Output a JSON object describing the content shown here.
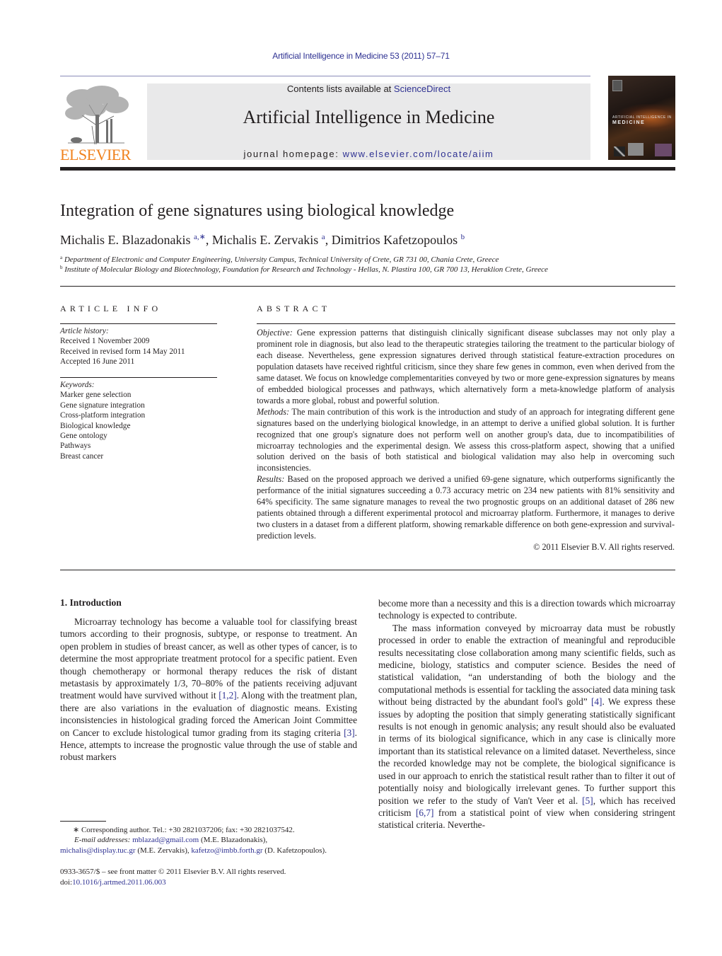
{
  "running_head": "Artificial Intelligence in Medicine 53 (2011) 57–71",
  "masthead": {
    "publisher_logo": "ELSEVIER",
    "contents_prefix": "Contents lists available at ",
    "contents_link": "ScienceDirect",
    "journal_title": "Artificial Intelligence in Medicine",
    "homepage_prefix": "journal homepage: ",
    "homepage_link": "www.elsevier.com/locate/aiim",
    "cover": {
      "line1": "ARTIFICIAL INTELLIGENCE IN",
      "line2": "MEDICINE"
    }
  },
  "article": {
    "title": "Integration of gene signatures using biological knowledge",
    "authors": [
      {
        "name": "Michalis E. Blazadonakis",
        "sup": "a,∗",
        "sep": ", "
      },
      {
        "name": "Michalis E. Zervakis",
        "sup": "a",
        "sep": ", "
      },
      {
        "name": "Dimitrios Kafetzopoulos",
        "sup": "b",
        "sep": ""
      }
    ],
    "affiliations": [
      {
        "key": "a",
        "text": "Department of Electronic and Computer Engineering, University Campus, Technical University of Crete, GR 731 00, Chania Crete, Greece"
      },
      {
        "key": "b",
        "text": "Institute of Molecular Biology and Biotechnology, Foundation for Research and Technology - Hellas, N. Plastira 100, GR 700 13, Heraklion Crete, Greece"
      }
    ]
  },
  "article_info": {
    "heading": "ARTICLE INFO",
    "history_label": "Article history:",
    "history": [
      "Received 1 November 2009",
      "Received in revised form 14 May 2011",
      "Accepted 16 June 2011"
    ],
    "keywords_label": "Keywords:",
    "keywords": [
      "Marker gene selection",
      "Gene signature integration",
      "Cross-platform integration",
      "Biological knowledge",
      "Gene ontology",
      "Pathways",
      "Breast cancer"
    ]
  },
  "abstract": {
    "heading": "ABSTRACT",
    "objective_label": "Objective:",
    "objective": " Gene expression patterns that distinguish clinically significant disease subclasses may not only play a prominent role in diagnosis, but also lead to the therapeutic strategies tailoring the treatment to the particular biology of each disease. Nevertheless, gene expression signatures derived through statistical feature-extraction procedures on population datasets have received rightful criticism, since they share few genes in common, even when derived from the same dataset. We focus on knowledge complementarities conveyed by two or more gene-expression signatures by means of embedded biological processes and pathways, which alternatively form a meta-knowledge platform of analysis towards a more global, robust and powerful solution.",
    "methods_label": "Methods:",
    "methods": " The main contribution of this work is the introduction and study of an approach for integrating different gene signatures based on the underlying biological knowledge, in an attempt to derive a unified global solution. It is further recognized that one group's signature does not perform well on another group's data, due to incompatibilities of microarray technologies and the experimental design. We assess this cross-platform aspect, showing that a unified solution derived on the basis of both statistical and biological validation may also help in overcoming such inconsistencies.",
    "results_label": "Results:",
    "results": " Based on the proposed approach we derived a unified 69-gene signature, which outperforms significantly the performance of the initial signatures succeeding a 0.73 accuracy metric on 234 new patients with 81% sensitivity and 64% specificity. The same signature manages to reveal the two prognostic groups on an additional dataset of 286 new patients obtained through a different experimental protocol and microarray platform. Furthermore, it manages to derive two clusters in a dataset from a different platform, showing remarkable difference on both gene-expression and survival-prediction levels.",
    "copyright": "© 2011 Elsevier B.V. All rights reserved."
  },
  "body": {
    "section_heading": "1.  Introduction",
    "left_p1_a": "Microarray technology has become a valuable tool for classifying breast tumors according to their prognosis, subtype, or response to treatment. An open problem in studies of breast cancer, as well as other types of cancer, is to determine the most appropriate treatment protocol for a specific patient. Even though chemotherapy or hormonal therapy reduces the risk of distant metastasis by approximately 1/3, 70–80% of the patients receiving adjuvant treatment would have survived without it ",
    "cite_1_2": "[1,2]",
    "left_p1_b": ". Along with the treatment plan, there are also variations in the evaluation of diagnostic means. Existing inconsistencies in histological grading forced the American Joint Committee on Cancer to exclude histological tumor grading from its staging criteria ",
    "cite_3": "[3]",
    "left_p1_c": ". Hence, attempts to increase the prognostic value through the use of stable and robust markers",
    "right_p1": "become more than a necessity and this is a direction towards which microarray technology is expected to contribute.",
    "right_p2_a": "The mass information conveyed by microarray data must be robustly processed in order to enable the extraction of meaningful and reproducible results necessitating close collaboration among many scientific fields, such as medicine, biology, statistics and computer science. Besides the need of statistical validation, “an understanding of both the biology and the computational methods is essential for tackling the associated data mining task without being distracted by the abundant fool's gold” ",
    "cite_4": "[4]",
    "right_p2_b": ". We express these issues by adopting the position that simply generating statistically significant results is not enough in genomic analysis; any result should also be evaluated in terms of its biological significance, which in any case is clinically more important than its statistical relevance on a limited dataset. Nevertheless, since the recorded knowledge may not be complete, the biological significance is used in our approach to enrich the statistical result rather than to filter it out of potentially noisy and biologically irrelevant genes. To further support this position we refer to the study of Van't Veer et al. ",
    "cite_5": "[5]",
    "right_p2_c": ", which has received criticism ",
    "cite_6_7": "[6,7]",
    "right_p2_d": " from a statistical point of view when considering stringent statistical criteria. Neverthe-"
  },
  "footnotes": {
    "corresponding": "∗ Corresponding author. Tel.: +30 2821037206; fax: +30 2821037542.",
    "email_label": "E-mail addresses:",
    "email1": "mblazad@gmail.com",
    "email1_owner": " (M.E. Blazadonakis),",
    "email2": "michalis@display.tuc.gr",
    "email2_owner": " (M.E. Zervakis), ",
    "email3": "kafetzo@imbb.forth.gr",
    "email3_owner": " (D. Kafetzopoulos).",
    "front_matter": "0933-3657/$ – see front matter © 2011 Elsevier B.V. All rights reserved.",
    "doi_prefix": "doi:",
    "doi_link": "10.1016/j.artmed.2011.06.003"
  }
}
